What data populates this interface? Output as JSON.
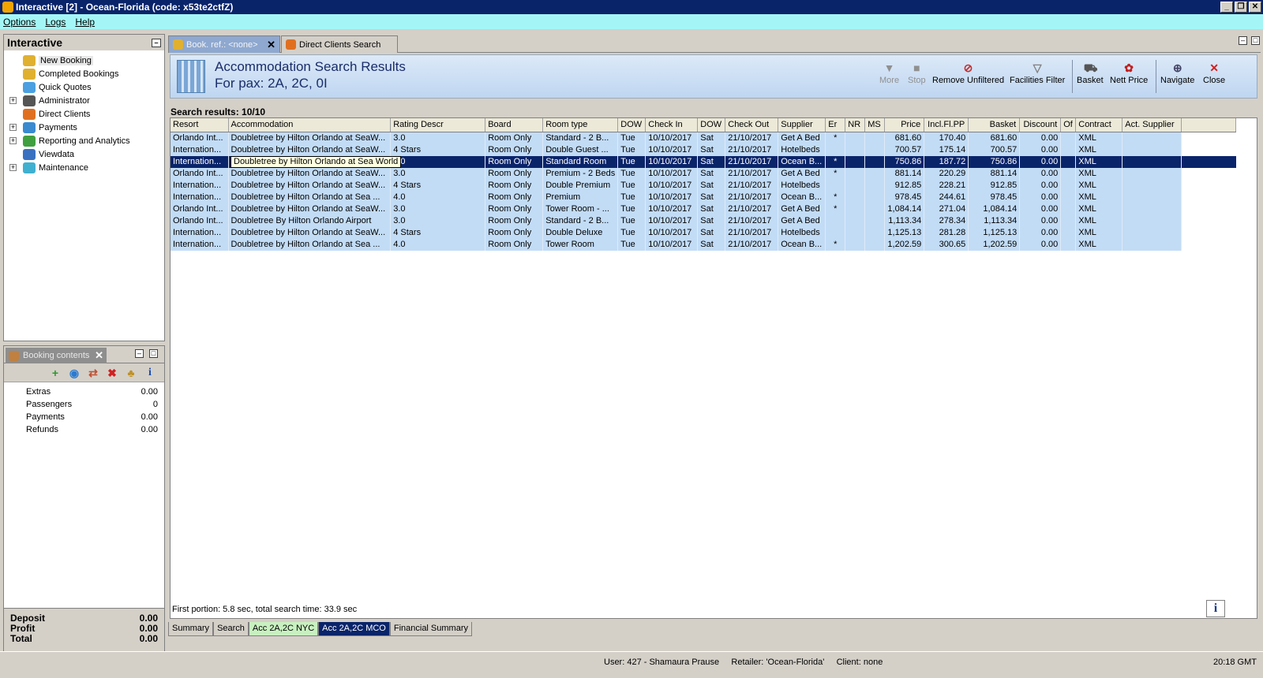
{
  "window": {
    "title": "Interactive [2] - Ocean-Florida (code: x53te2ctfZ)"
  },
  "menu": [
    "Options",
    "Logs",
    "Help"
  ],
  "left": {
    "title": "Interactive",
    "tree": [
      {
        "label": "New Booking",
        "expandable": false,
        "color": "#e0b030"
      },
      {
        "label": "Completed Bookings",
        "expandable": false,
        "color": "#e0b030"
      },
      {
        "label": "Quick Quotes",
        "expandable": false,
        "color": "#4aa0e0"
      },
      {
        "label": "Administrator",
        "expandable": true,
        "color": "#555555"
      },
      {
        "label": "Direct Clients",
        "expandable": false,
        "color": "#e07020"
      },
      {
        "label": "Payments",
        "expandable": true,
        "color": "#3a8ad0"
      },
      {
        "label": "Reporting and Analytics",
        "expandable": true,
        "color": "#40a040"
      },
      {
        "label": "Viewdata",
        "expandable": false,
        "color": "#3a70c0"
      },
      {
        "label": "Maintenance",
        "expandable": true,
        "color": "#40b0d0"
      }
    ]
  },
  "booking": {
    "tab": "Booking contents",
    "rows": [
      {
        "label": "Extras",
        "value": "0.00"
      },
      {
        "label": "Passengers",
        "value": "0"
      },
      {
        "label": "Payments",
        "value": "0.00"
      },
      {
        "label": "Refunds",
        "value": "0.00"
      }
    ],
    "summary": [
      {
        "label": "Deposit",
        "value": "0.00"
      },
      {
        "label": "Profit",
        "value": "0.00"
      },
      {
        "label": "Total",
        "value": "0.00"
      }
    ]
  },
  "tabs": {
    "tab1": "Book. ref.: <none>",
    "tab2": "Direct Clients Search"
  },
  "header": {
    "title": "Accommodation Search Results",
    "subtitle": "For pax: 2A, 2C, 0I"
  },
  "toolbar": {
    "more": "More",
    "stop": "Stop",
    "remove": "Remove Unfiltered",
    "facilities": "Facilities Filter",
    "basket": "Basket",
    "nett": "Nett Price",
    "navigate": "Navigate",
    "close": "Close"
  },
  "results": {
    "label": "Search results: 10/10",
    "columns": [
      "Resort",
      "Accommodation",
      "Rating Descr",
      "Board",
      "Room type",
      "DOW",
      "Check In",
      "DOW",
      "Check Out",
      "Supplier",
      "Er",
      "NR",
      "MS",
      "Price",
      "Incl.Fl.PP",
      "Basket",
      "Discount",
      "Of",
      "Contract",
      "Act. Supplier"
    ],
    "rows": [
      [
        "Orlando Int...",
        "Doubletree by Hilton Orlando at SeaW...",
        "3.0",
        "Room Only",
        "Standard - 2 B...",
        "Tue",
        "10/10/2017",
        "Sat",
        "21/10/2017",
        "Get A Bed",
        "*",
        "",
        "",
        "681.60",
        "170.40",
        "681.60",
        "0.00",
        "",
        "XML",
        ""
      ],
      [
        "Internation...",
        "Doubletree by Hilton Orlando at SeaW...",
        "4 Stars",
        "Room Only",
        "Double Guest ...",
        "Tue",
        "10/10/2017",
        "Sat",
        "21/10/2017",
        "Hotelbeds",
        "",
        "",
        "",
        "700.57",
        "175.14",
        "700.57",
        "0.00",
        "",
        "XML",
        ""
      ],
      [
        "Internation...",
        "Doubletree by Hilton Orlando at Sea W...",
        "4.0",
        "Room Only",
        "Standard Room",
        "Tue",
        "10/10/2017",
        "Sat",
        "21/10/2017",
        "Ocean B...",
        "*",
        "",
        "",
        "750.86",
        "187.72",
        "750.86",
        "0.00",
        "",
        "XML",
        ""
      ],
      [
        "Orlando Int...",
        "Doubletree by Hilton Orlando at SeaW...",
        "3.0",
        "Room Only",
        "Premium - 2 Beds",
        "Tue",
        "10/10/2017",
        "Sat",
        "21/10/2017",
        "Get A Bed",
        "*",
        "",
        "",
        "881.14",
        "220.29",
        "881.14",
        "0.00",
        "",
        "XML",
        ""
      ],
      [
        "Internation...",
        "Doubletree by Hilton Orlando at SeaW...",
        "4 Stars",
        "Room Only",
        "Double Premium",
        "Tue",
        "10/10/2017",
        "Sat",
        "21/10/2017",
        "Hotelbeds",
        "",
        "",
        "",
        "912.85",
        "228.21",
        "912.85",
        "0.00",
        "",
        "XML",
        ""
      ],
      [
        "Internation...",
        "Doubletree by Hilton Orlando at Sea ...",
        "4.0",
        "Room Only",
        "Premium",
        "Tue",
        "10/10/2017",
        "Sat",
        "21/10/2017",
        "Ocean B...",
        "*",
        "",
        "",
        "978.45",
        "244.61",
        "978.45",
        "0.00",
        "",
        "XML",
        ""
      ],
      [
        "Orlando Int...",
        "Doubletree by Hilton Orlando at SeaW...",
        "3.0",
        "Room Only",
        "Tower Room - ...",
        "Tue",
        "10/10/2017",
        "Sat",
        "21/10/2017",
        "Get A Bed",
        "*",
        "",
        "",
        "1,084.14",
        "271.04",
        "1,084.14",
        "0.00",
        "",
        "XML",
        ""
      ],
      [
        "Orlando Int...",
        "Doubletree By Hilton Orlando Airport",
        "3.0",
        "Room Only",
        "Standard - 2 B...",
        "Tue",
        "10/10/2017",
        "Sat",
        "21/10/2017",
        "Get A Bed",
        "",
        "",
        "",
        "1,113.34",
        "278.34",
        "1,113.34",
        "0.00",
        "",
        "XML",
        ""
      ],
      [
        "Internation...",
        "Doubletree by Hilton Orlando at SeaW...",
        "4 Stars",
        "Room Only",
        "Double Deluxe",
        "Tue",
        "10/10/2017",
        "Sat",
        "21/10/2017",
        "Hotelbeds",
        "",
        "",
        "",
        "1,125.13",
        "281.28",
        "1,125.13",
        "0.00",
        "",
        "XML",
        ""
      ],
      [
        "Internation...",
        "Doubletree by Hilton Orlando at Sea ...",
        "4.0",
        "Room Only",
        "Tower Room",
        "Tue",
        "10/10/2017",
        "Sat",
        "21/10/2017",
        "Ocean B...",
        "*",
        "",
        "",
        "1,202.59",
        "300.65",
        "1,202.59",
        "0.00",
        "",
        "XML",
        ""
      ]
    ],
    "selected_row": 2,
    "tooltip": "Doubletree by Hilton Orlando at Sea World",
    "timing": "First portion: 5.8 sec, total search time: 33.9 sec"
  },
  "bottom_tabs": [
    "Summary",
    "Search",
    "Acc 2A,2C NYC",
    "Acc 2A,2C MCO",
    "Financial Summary"
  ],
  "status": {
    "user": "User: 427 - Shamaura Prause     Retailer: 'Ocean-Florida'     Client: none",
    "time": "20:18 GMT"
  }
}
